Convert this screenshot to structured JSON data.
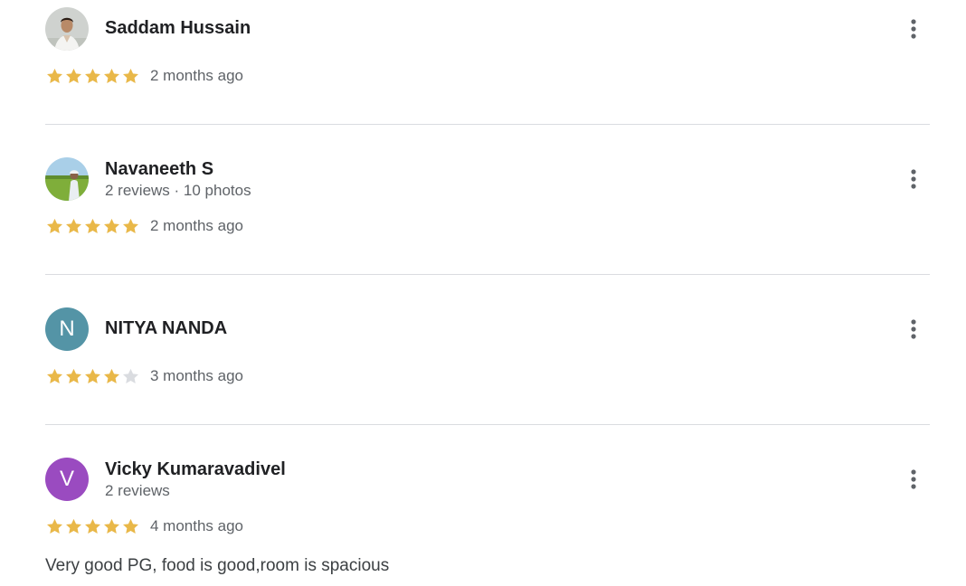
{
  "reviews": [
    {
      "reviewer_name": "Saddam Hussain",
      "reviewer_meta": "",
      "avatar": {
        "type": "photo",
        "icon": "person-photo-avatar"
      },
      "rating": 5,
      "max_rating": 5,
      "date": "2 months ago",
      "text": ""
    },
    {
      "reviewer_name": "Navaneeth S",
      "reviewer_meta": "2 reviews · 10 photos",
      "avatar": {
        "type": "photo",
        "icon": "landscape-photo-avatar"
      },
      "rating": 5,
      "max_rating": 5,
      "date": "2 months ago",
      "text": ""
    },
    {
      "reviewer_name": "NITYA NANDA",
      "reviewer_meta": "",
      "avatar": {
        "type": "letter",
        "letter": "N",
        "color": "#5494a6"
      },
      "rating": 4,
      "max_rating": 5,
      "date": "3 months ago",
      "text": ""
    },
    {
      "reviewer_name": "Vicky Kumaravadivel",
      "reviewer_meta": "2 reviews",
      "avatar": {
        "type": "letter",
        "letter": "V",
        "color": "#9a4bc0"
      },
      "rating": 5,
      "max_rating": 5,
      "date": "4 months ago",
      "text": "Very good PG, food is good,room is spacious"
    }
  ],
  "colors": {
    "star_filled": "#e9b849",
    "star_empty": "#dadce0",
    "divider": "#dadce0"
  },
  "icons": {
    "more_options": "more-vert-icon",
    "star": "star-icon"
  }
}
